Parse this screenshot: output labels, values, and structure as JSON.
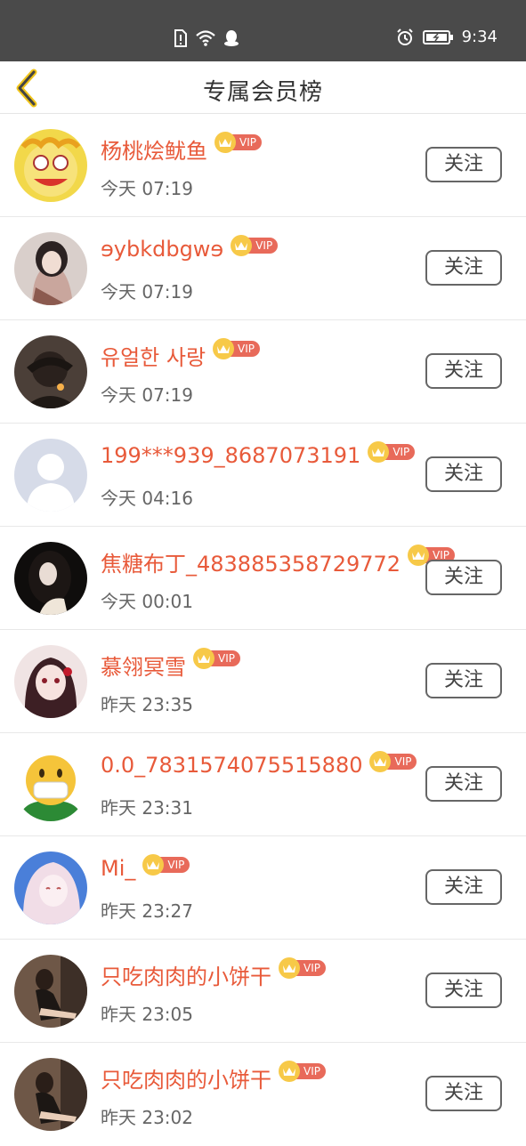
{
  "status_bar": {
    "time": "9:34"
  },
  "header": {
    "title": "专属会员榜"
  },
  "vip_label": "VIP",
  "follow_label": "关注",
  "members": [
    {
      "name": "杨桃烩鱿鱼",
      "time": "今天 07:19",
      "avatar": "cartoon-face"
    },
    {
      "name": "ɘybkdbgwɘ",
      "time": "今天 07:19",
      "avatar": "girl-photo"
    },
    {
      "name": "유얼한 사랑",
      "time": "今天 07:19",
      "avatar": "dark-photo"
    },
    {
      "name": "199***939_8687073191",
      "time": "今天 04:16",
      "avatar": "default-silhouette"
    },
    {
      "name": "焦糖布丁_483885358729772",
      "time": "今天 00:01",
      "avatar": "dark-hair-photo"
    },
    {
      "name": "慕翎冥雪",
      "time": "昨天 23:35",
      "avatar": "anime-girl"
    },
    {
      "name": "0.0_7831574075515880",
      "time": "昨天 23:31",
      "avatar": "mask-emoji"
    },
    {
      "name": "Mi_",
      "time": "昨天 23:27",
      "avatar": "anime-pink"
    },
    {
      "name": "只吃肉肉的小饼干",
      "time": "昨天 23:05",
      "avatar": "woman-photo"
    },
    {
      "name": "只吃肉肉的小饼干",
      "time": "昨天 23:02",
      "avatar": "woman-photo"
    }
  ]
}
